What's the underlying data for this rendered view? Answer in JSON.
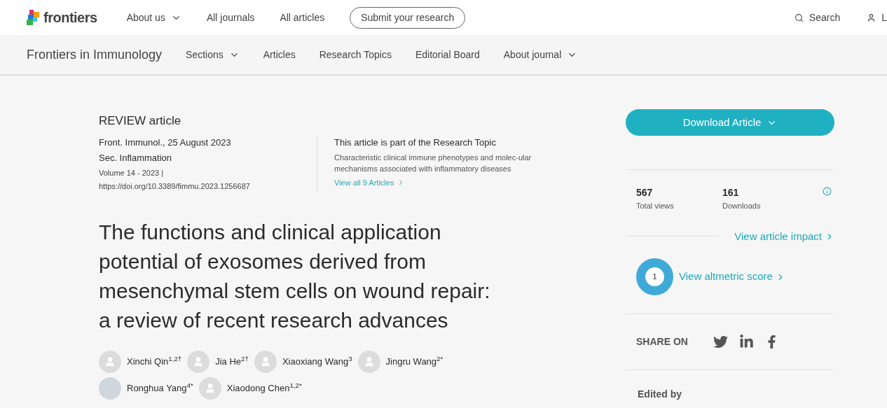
{
  "top_nav": {
    "logo": "frontiers",
    "items": [
      {
        "label": "About us",
        "dropdown": true
      },
      {
        "label": "All journals",
        "dropdown": false
      },
      {
        "label": "All articles",
        "dropdown": false
      }
    ],
    "submit_button": "Submit your research",
    "search": "Search",
    "login": "L"
  },
  "journal_nav": {
    "title": "Frontiers in Immunology",
    "items": [
      {
        "label": "Sections",
        "dropdown": true
      },
      {
        "label": "Articles",
        "dropdown": false
      },
      {
        "label": "Research Topics",
        "dropdown": false
      },
      {
        "label": "Editorial Board",
        "dropdown": false
      },
      {
        "label": "About journal",
        "dropdown": true
      }
    ]
  },
  "article": {
    "type": "REVIEW article",
    "journal_date": "Front. Immunol., 25 August 2023",
    "section": "Sec. Inflammation",
    "volume": "Volume 14 - 2023 |",
    "doi": "https://doi.org/10.3389/fimmu.2023.1256687",
    "research_topic": {
      "heading": "This article is part of the Research Topic",
      "title": "Characteristic clinical immune phenotypes and molec-ular mechanisms associated with inflammatory diseases",
      "link": "View all 9 Articles"
    },
    "title": "The functions and clinical application potential of exosomes derived from mesenchymal stem cells on wound repair: a review of recent research advances",
    "authors": [
      {
        "name": "Xinchi Qin$^{1,2†}$",
        "kind": "generic"
      },
      {
        "name": "Jia He$^{2†}$",
        "kind": "generic"
      },
      {
        "name": "Xiaoxiang Wang$^{3}$",
        "kind": "generic"
      },
      {
        "name": "Jingru Wang$^{2*}$",
        "kind": "generic"
      },
      {
        "name": "Ronghua Yang$^{4*}$",
        "kind": "photo"
      },
      {
        "name": "Xiaodong Chen$^{1,2*}$",
        "kind": "generic"
      }
    ]
  },
  "sidebar": {
    "download_button": "Download Article",
    "stats": [
      {
        "value": "567",
        "label": "Total views"
      },
      {
        "value": "161",
        "label": "Downloads"
      }
    ],
    "impact_link": "View article impact",
    "altmetric_score": "1",
    "altmetric_link": "View altmetric score",
    "share_label": "SHARE ON",
    "edited_by": "Edited by"
  }
}
